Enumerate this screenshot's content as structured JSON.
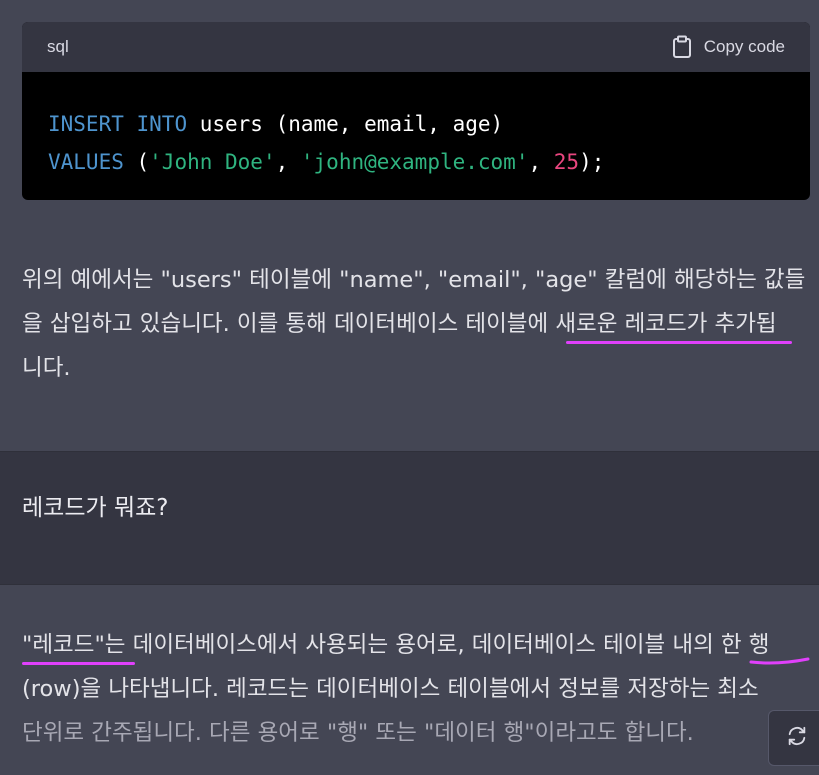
{
  "code_block": {
    "language": "sql",
    "copy_label": "Copy code",
    "line1": {
      "kw1": "INSERT",
      "kw2": "INTO",
      "rest": " users (name, email, age)"
    },
    "line2": {
      "kw": "VALUES",
      "open": " (",
      "s1": "'John Doe'",
      "sep1": ", ",
      "s2": "'john@example.com'",
      "sep2": ", ",
      "n": "25",
      "close": ");"
    }
  },
  "answer1": {
    "line1": "위의 예에서는 \"users\" 테이블에 \"name\", \"email\", \"age\" 칼럼에 해당하는 값들",
    "line2": "을 삽입하고 있습니다. 이를 통해 데이터베이스 테이블에 새로운 레코드가 추가됩",
    "line3": "니다."
  },
  "user_message": "레코드가 뭐죠?",
  "answer2": {
    "line1": "\"레코드\"는 데이터베이스에서 사용되는 용어로, 데이터베이스 테이블 내의 한 행",
    "line2": "(row)을 나타냅니다. 레코드는 데이터베이스 테이블에서 정보를 저장하는 최소",
    "line3": "단위로 간주됩니다. 다른 용어로 \"행\" 또는 \"데이터 행\"이라고도 합니다."
  },
  "icons": {
    "copy": "clipboard-icon",
    "regenerate": "refresh-icon"
  },
  "colors": {
    "highlight": "#e040fb",
    "keyword": "#4e94ce",
    "string": "#2fb480",
    "number": "#e9467f"
  }
}
